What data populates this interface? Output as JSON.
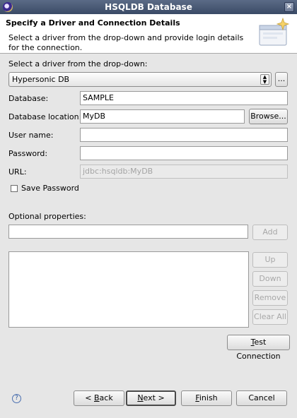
{
  "window": {
    "title": "HSQLDB Database",
    "close_glyph": "×"
  },
  "header": {
    "title": "Specify a Driver and Connection Details",
    "description": "Select a driver from the drop-down and provide login details for the connection."
  },
  "driver": {
    "label": "Select a driver from the drop-down:",
    "selected": "Hypersonic DB",
    "browse_label": "..."
  },
  "fields": {
    "database": {
      "label": "Database:",
      "value": "SAMPLE"
    },
    "location": {
      "label": "Database location:",
      "value": "MyDB",
      "browse_label": "Browse..."
    },
    "username": {
      "label": "User name:",
      "value": ""
    },
    "password": {
      "label": "Password:",
      "value": ""
    },
    "url": {
      "label": "URL:",
      "value": "jdbc:hsqldb:MyDB"
    }
  },
  "save_password": {
    "label": "Save Password",
    "checked": false
  },
  "optional": {
    "label": "Optional properties:",
    "value": "",
    "add_label": "Add",
    "up_label": "Up",
    "down_label": "Down",
    "remove_label": "Remove",
    "clear_all_label": "Clear All"
  },
  "test_connection": {
    "prefix": "T",
    "rest": "est Connection"
  },
  "footer": {
    "help_glyph": "?",
    "back": {
      "pre": "< ",
      "mn": "B",
      "post": "ack"
    },
    "next": {
      "mn": "N",
      "post": "ext >"
    },
    "finish": {
      "mn": "F",
      "post": "inish"
    },
    "cancel_label": "Cancel"
  },
  "icons": [
    "eclipse-icon",
    "close-icon",
    "wizard-banner-icon",
    "chevron-updown-icon",
    "help-icon"
  ]
}
